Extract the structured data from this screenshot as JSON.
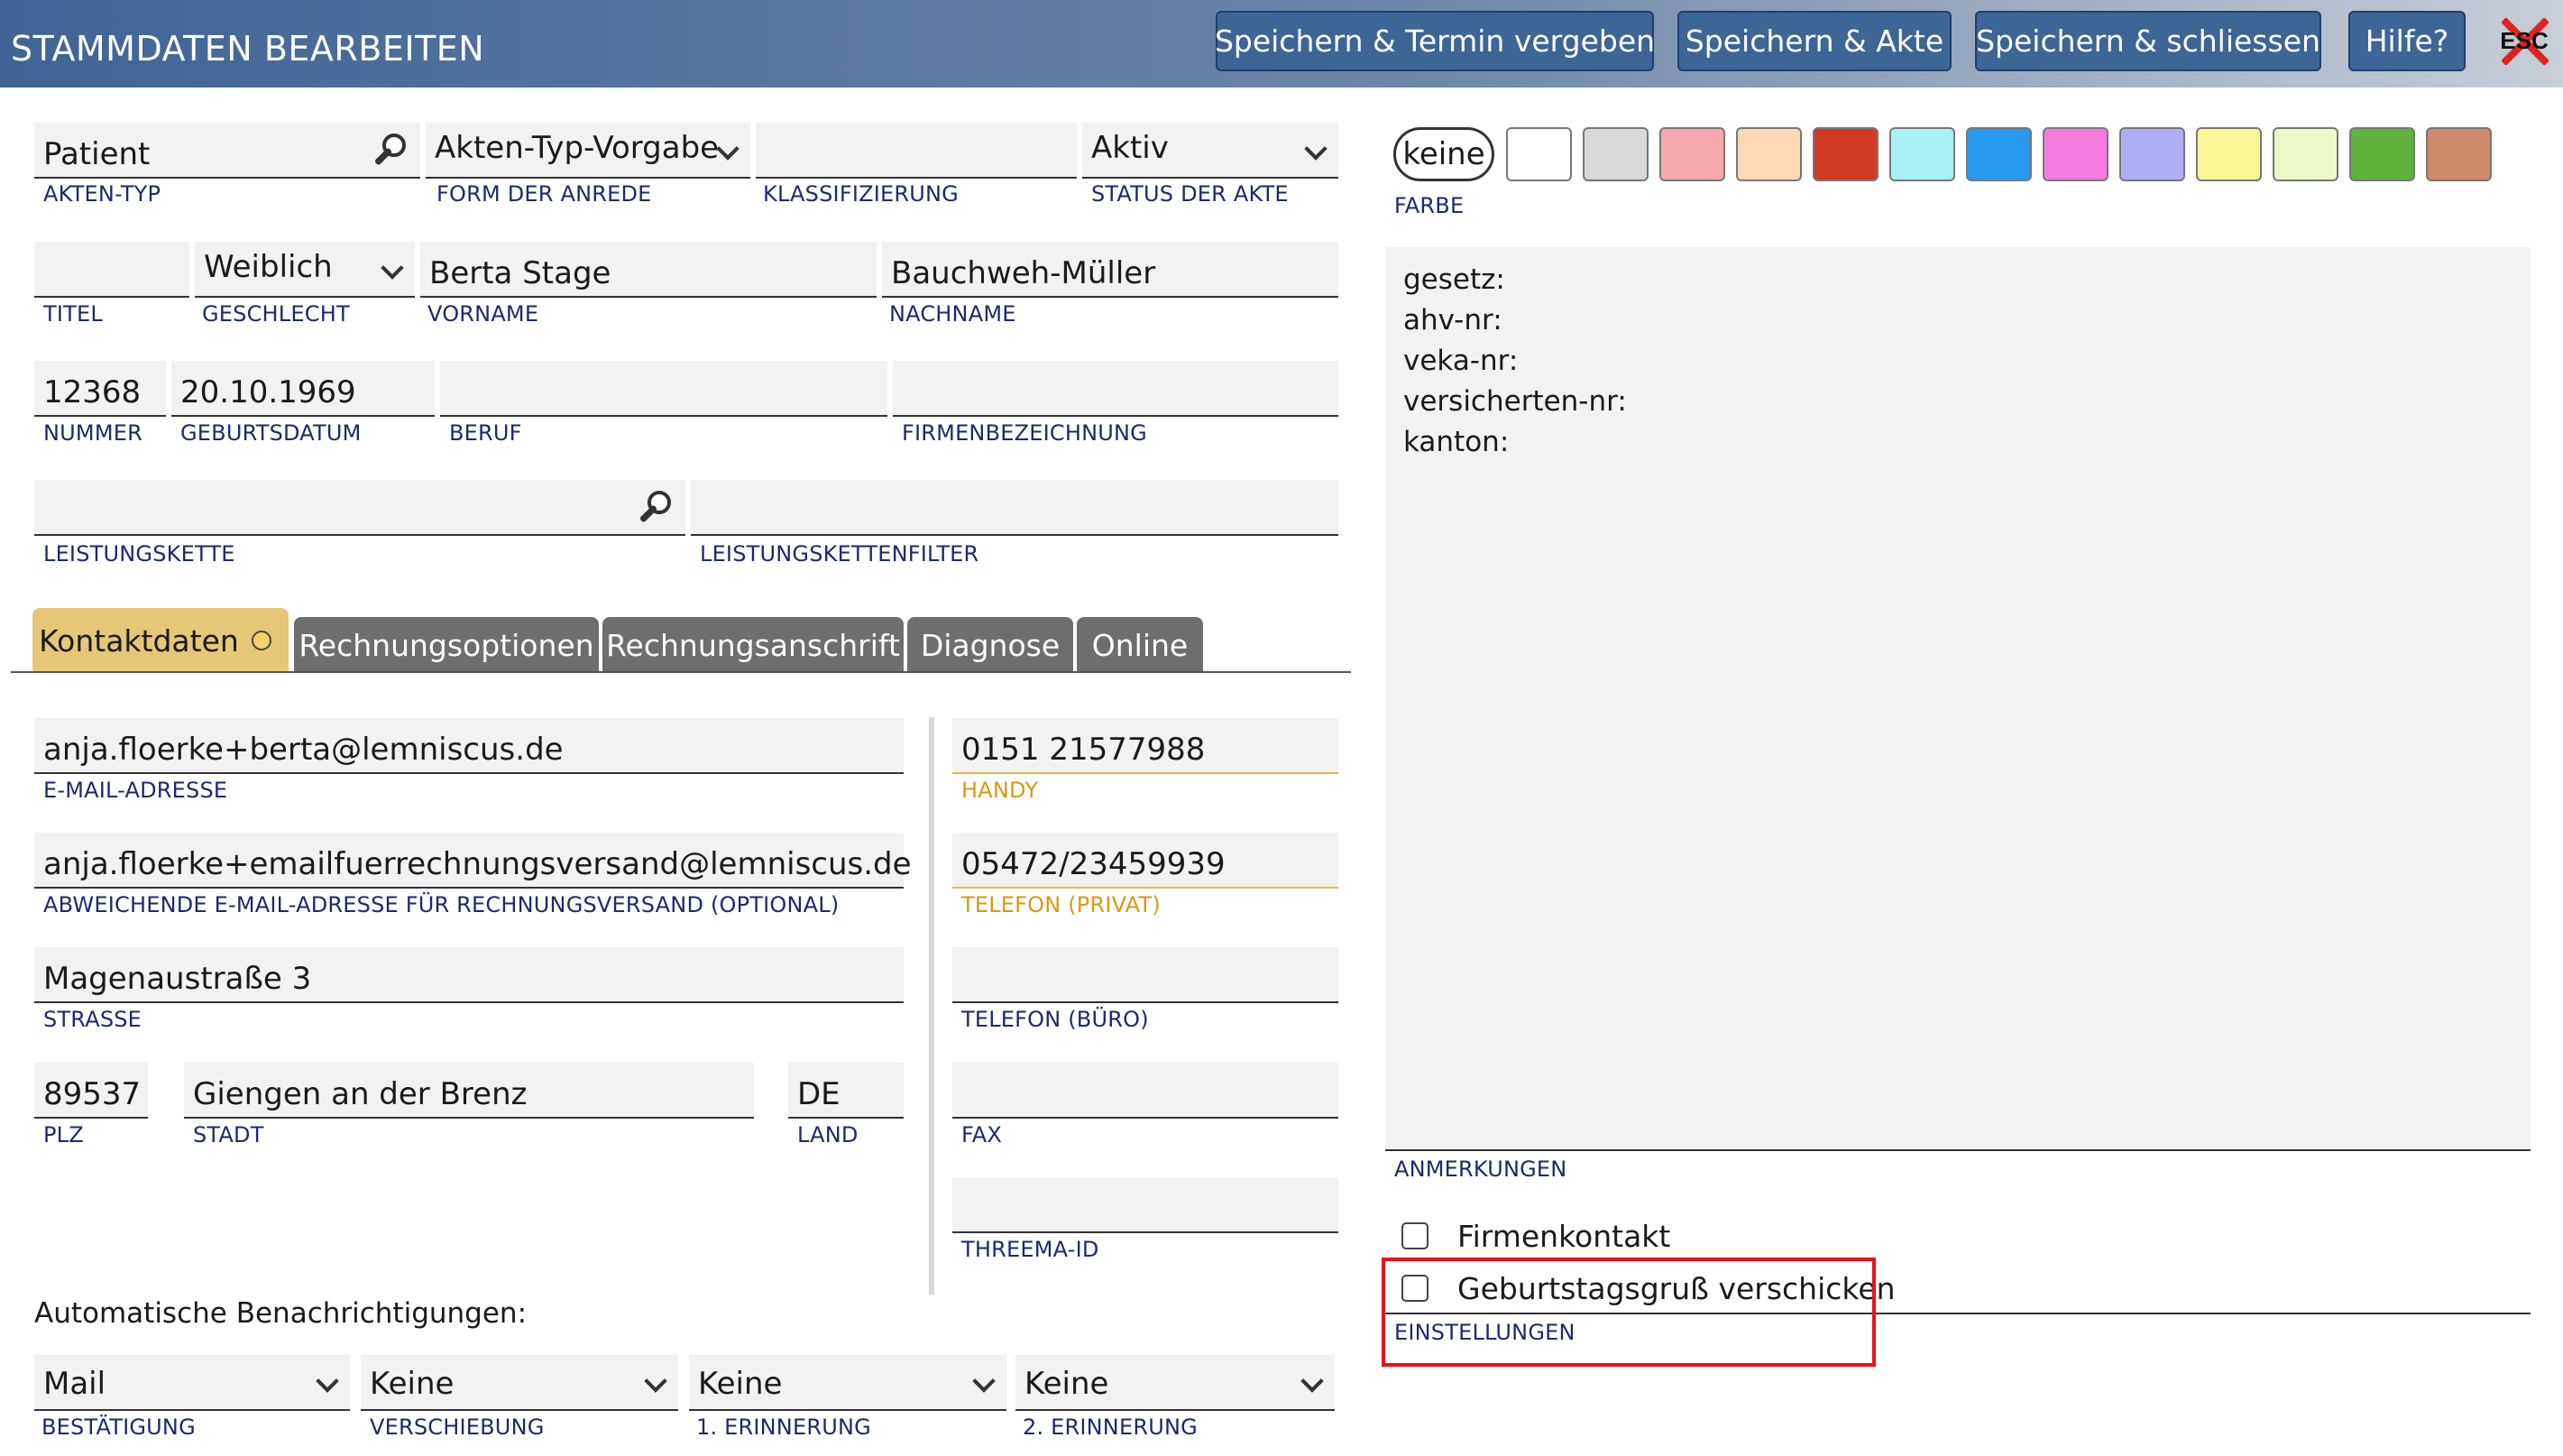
{
  "header": {
    "title": "STAMMDATEN BEARBEITEN",
    "buttons": [
      "Speichern & Termin vergeben",
      "Speichern & Akte",
      "Speichern & schliessen",
      "Hilfe?"
    ],
    "esc_label": "ESC"
  },
  "fields": {
    "akten_typ": {
      "value": "Patient",
      "label": "AKTEN-TYP"
    },
    "anrede": {
      "value": "Akten-Typ-Vorgabe",
      "label": "FORM DER ANREDE"
    },
    "klassifizierung": {
      "value": "",
      "label": "KLASSIFIZIERUNG"
    },
    "status": {
      "value": "Aktiv",
      "label": "STATUS DER AKTE"
    },
    "titel": {
      "value": "",
      "label": "TITEL"
    },
    "geschlecht": {
      "value": "Weiblich",
      "label": "GESCHLECHT"
    },
    "vorname": {
      "value": "Berta Stage",
      "label": "VORNAME"
    },
    "nachname": {
      "value": "Bauchweh-Müller",
      "label": "NACHNAME"
    },
    "nummer": {
      "value": "12368",
      "label": "NUMMER"
    },
    "geburtsdatum": {
      "value": "20.10.1969",
      "label": "GEBURTSDATUM"
    },
    "beruf": {
      "value": "",
      "label": "BERUF"
    },
    "firma": {
      "value": "",
      "label": "FIRMENBEZEICHNUNG"
    },
    "leistungskette": {
      "value": "",
      "label": "LEISTUNGSKETTE"
    },
    "leistungsfilter": {
      "value": "",
      "label": "LEISTUNGSKETTENFILTER"
    }
  },
  "tabs": [
    "Kontaktdaten",
    "Rechnungsoptionen",
    "Rechnungsanschrift",
    "Diagnose",
    "Online"
  ],
  "contact": {
    "email": {
      "value": "anja.floerke+berta@lemniscus.de",
      "label": "E-MAIL-ADRESSE"
    },
    "email_rechnung": {
      "value": "anja.floerke+emailfuerrechnungsversand@lemniscus.de",
      "label": "ABWEICHENDE E-MAIL-ADRESSE FÜR RECHNUNGSVERSAND (OPTIONAL)"
    },
    "strasse": {
      "value": "Magenaustraße 3",
      "label": "STRASSE"
    },
    "plz": {
      "value": "89537",
      "label": "PLZ"
    },
    "stadt": {
      "value": "Giengen an der Brenz",
      "label": "STADT"
    },
    "land": {
      "value": "DE",
      "label": "LAND"
    },
    "handy": {
      "value": "0151 21577988",
      "label": "HANDY"
    },
    "tel_privat": {
      "value": "05472/23459939",
      "label": "TELEFON (PRIVAT)"
    },
    "tel_buero": {
      "value": "",
      "label": "TELEFON (BÜRO)"
    },
    "fax": {
      "value": "",
      "label": "FAX"
    },
    "threema": {
      "value": "",
      "label": "THREEMA-ID"
    }
  },
  "notifications": {
    "heading": "Automatische Benachrichtigungen:",
    "bestaetigung": {
      "value": "Mail",
      "label": "BESTÄTIGUNG"
    },
    "verschiebung": {
      "value": "Keine",
      "label": "VERSCHIEBUNG"
    },
    "erinnerung1": {
      "value": "Keine",
      "label": "1. ERINNERUNG"
    },
    "erinnerung2": {
      "value": "Keine",
      "label": "2. ERINNERUNG"
    }
  },
  "farbe": {
    "keine_label": "keine",
    "label": "FARBE",
    "swatches": [
      "#ffffff",
      "#d9d9d9",
      "#f7a8ad",
      "#fcd8b4",
      "#d13a22",
      "#a8f2f7",
      "#2799ee",
      "#f57ae0",
      "#aeaef7",
      "#f9f798",
      "#ebf9c8",
      "#5fb23a",
      "#cf8a6b"
    ]
  },
  "anmerkungen": {
    "lines": [
      "gesetz:",
      "ahv-nr:",
      "veka-nr:",
      "versicherten-nr:",
      "kanton:"
    ],
    "label": "ANMERKUNGEN"
  },
  "einstellungen": {
    "firmenkontakt": "Firmenkontakt",
    "geburtstagsgruss": "Geburtstagsgruß verschicken",
    "label": "EINSTELLUNGEN"
  },
  "colors": {
    "accent": "#3d6596",
    "label": "#1d2a6b",
    "active_tab": "#e6c777",
    "highlight": "#e8121c"
  }
}
